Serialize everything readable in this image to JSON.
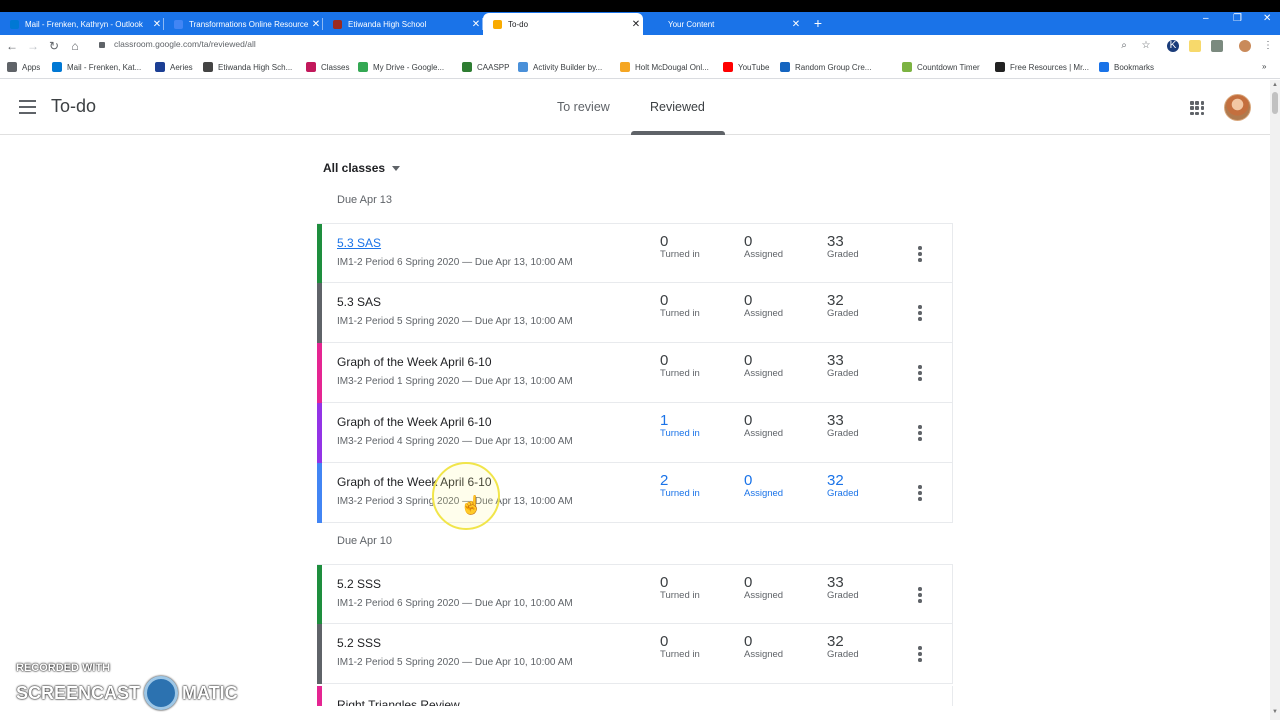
{
  "browser": {
    "tabs": [
      {
        "title": "Mail - Frenken, Kathryn - Outlook",
        "icon_color": "#0078d4",
        "active": false
      },
      {
        "title": "Transformations Online Resource",
        "icon_color": "#4285f4",
        "active": false
      },
      {
        "title": "Etiwanda High School",
        "icon_color": "#9c2a1f",
        "active": false
      },
      {
        "title": "To-do",
        "icon_color": "#f9ab00",
        "active": true
      },
      {
        "title": "Your Content",
        "icon_color": "#1a73e8",
        "active": false
      }
    ],
    "new_tab": "+",
    "url": "classroom.google.com/ta/reviewed/all",
    "bookmarks": [
      {
        "label": "Apps",
        "icon_color": "#5f6368"
      },
      {
        "label": "Mail - Frenken, Kat...",
        "icon_color": "#0078d4"
      },
      {
        "label": "Aeries",
        "icon_color": "#1c3f94"
      },
      {
        "label": "Etiwanda High Sch...",
        "icon_color": "#444444"
      },
      {
        "label": "Classes",
        "icon_color": "#c2185b"
      },
      {
        "label": "My Drive - Google...",
        "icon_color": "#34a853"
      },
      {
        "label": "CAASPP",
        "icon_color": "#2e7d32"
      },
      {
        "label": "Activity Builder by...",
        "icon_color": "#4a90d9"
      },
      {
        "label": "Holt McDougal Onl...",
        "icon_color": "#f5a623"
      },
      {
        "label": "YouTube",
        "icon_color": "#ff0000"
      },
      {
        "label": "Random Group Cre...",
        "icon_color": "#1565c0"
      },
      {
        "label": "Countdown Timer",
        "icon_color": "#7cb342"
      },
      {
        "label": "Free Resources | Mr...",
        "icon_color": "#222222"
      },
      {
        "label": "Bookmarks",
        "icon_color": "#1a73e8"
      }
    ]
  },
  "header": {
    "title": "To-do",
    "tabs": [
      {
        "label": "To review",
        "selected": false
      },
      {
        "label": "Reviewed",
        "selected": true
      }
    ]
  },
  "filter": {
    "label": "All classes"
  },
  "groups": [
    {
      "due_label": "Due Apr 13",
      "items": [
        {
          "title": "5.3 SAS",
          "subtitle": "IM1-2 Period 6 Spring 2020 — Due Apr 13, 10:00 AM",
          "color": "#1e8e3e",
          "turned_in": "0",
          "assigned": "0",
          "graded": "33",
          "link": true,
          "highlight": false
        },
        {
          "title": "5.3 SAS",
          "subtitle": "IM1-2 Period 5 Spring 2020 — Due Apr 13, 10:00 AM",
          "color": "#5f6368",
          "turned_in": "0",
          "assigned": "0",
          "graded": "32",
          "link": false,
          "highlight": false
        },
        {
          "title": "Graph of the Week April 6-10",
          "subtitle": "IM3-2 Period 1 Spring 2020 — Due Apr 13, 10:00 AM",
          "color": "#e52592",
          "turned_in": "0",
          "assigned": "0",
          "graded": "33",
          "link": false,
          "highlight": false
        },
        {
          "title": "Graph of the Week April 6-10",
          "subtitle": "IM3-2 Period 4 Spring 2020 — Due Apr 13, 10:00 AM",
          "color": "#9334e6",
          "turned_in": "1",
          "assigned": "0",
          "graded": "33",
          "link": false,
          "highlight": false
        },
        {
          "title": "Graph of the Week April 6-10",
          "subtitle": "IM3-2 Period 3 Spring 2020 — Due Apr 13, 10:00 AM",
          "color": "#4285f4",
          "turned_in": "2",
          "assigned": "0",
          "graded": "32",
          "link": false,
          "highlight": true
        }
      ]
    },
    {
      "due_label": "Due Apr 10",
      "items": [
        {
          "title": "5.2 SSS",
          "subtitle": "IM1-2 Period 6 Spring 2020 — Due Apr 10, 10:00 AM",
          "color": "#1e8e3e",
          "turned_in": "0",
          "assigned": "0",
          "graded": "33",
          "link": false,
          "highlight": false
        },
        {
          "title": "5.2 SSS",
          "subtitle": "IM1-2 Period 5 Spring 2020 — Due Apr 10, 10:00 AM",
          "color": "#5f6368",
          "turned_in": "0",
          "assigned": "0",
          "graded": "32",
          "link": false,
          "highlight": false
        }
      ]
    }
  ],
  "partial_item": {
    "title": "Right Triangles Review",
    "color": "#e52592"
  },
  "stat_labels": {
    "turned_in": "Turned in",
    "assigned": "Assigned",
    "graded": "Graded"
  },
  "watermark": {
    "top": "RECORDED WITH",
    "left": "SCREENCAST",
    "right": "MATIC"
  }
}
